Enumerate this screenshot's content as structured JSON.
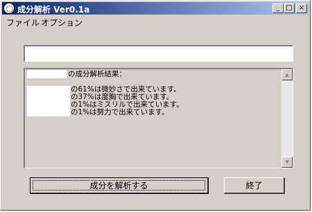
{
  "window": {
    "title": "成分解析 Ver0.1a",
    "controls": {
      "minimize": "_",
      "maximize": "□",
      "close": "×"
    }
  },
  "menu": [
    "ファイル",
    "オプション"
  ],
  "input": {
    "value": ""
  },
  "results": {
    "header": "の成分解析結果：",
    "lines": [
      "の61%は微妙さで出来ています。",
      "の37%は度胸で出来ています。",
      "の1%はミスリルで出来ています。",
      "の1%は努力で出来ています。"
    ]
  },
  "scrollbar": {
    "up": "▲",
    "down": "▼"
  },
  "buttons": {
    "analyze": "成分を解析する",
    "exit": "終了"
  }
}
